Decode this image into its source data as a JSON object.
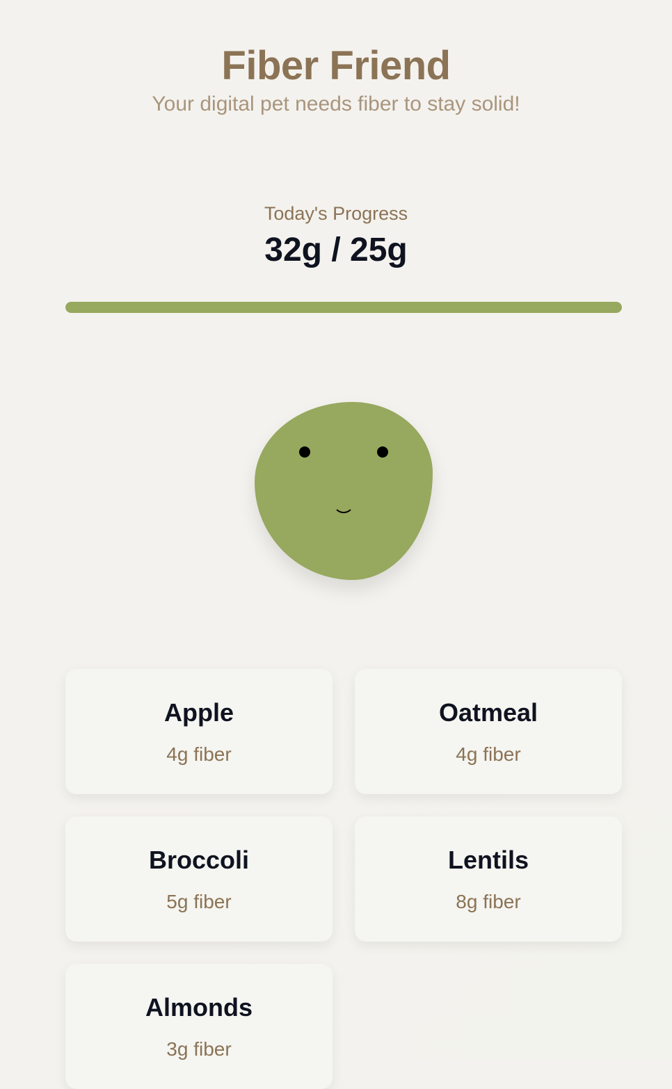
{
  "header": {
    "title": "Fiber Friend",
    "subtitle": "Your digital pet needs fiber to stay solid!"
  },
  "progress": {
    "label": "Today's Progress",
    "value_text": "32g / 25g",
    "current_g": 32,
    "goal_g": 25,
    "fill_percent": 100
  },
  "pet": {
    "mood": "happy",
    "body_color": "#97a85f"
  },
  "foods": [
    {
      "name": "Apple",
      "fiber": "4g fiber"
    },
    {
      "name": "Oatmeal",
      "fiber": "4g fiber"
    },
    {
      "name": "Broccoli",
      "fiber": "5g fiber"
    },
    {
      "name": "Lentils",
      "fiber": "8g fiber"
    },
    {
      "name": "Almonds",
      "fiber": "3g fiber"
    }
  ],
  "colors": {
    "accent": "#97a85f",
    "title": "#8b7355",
    "subtitle": "#a9957d",
    "text_dark": "#0f1320",
    "background": "#f4f2ee"
  }
}
